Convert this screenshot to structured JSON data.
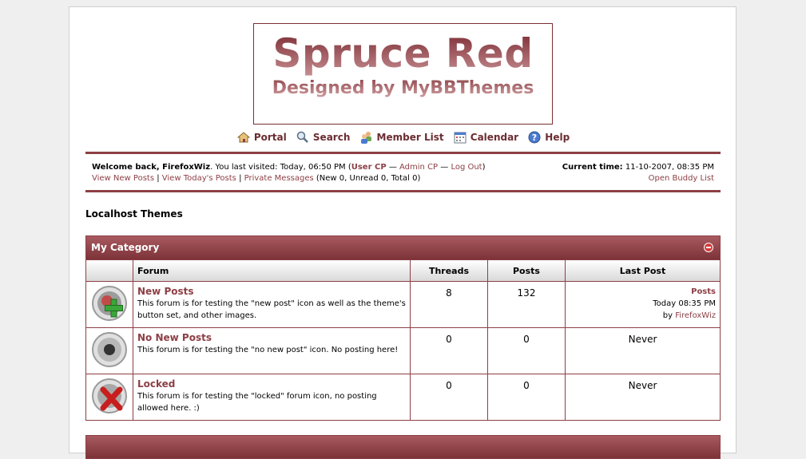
{
  "logo": {
    "title": "Spruce Red",
    "subtitle": "Designed by MyBBThemes"
  },
  "menu": [
    {
      "label": "Portal",
      "icon": "home-icon"
    },
    {
      "label": "Search",
      "icon": "search-icon"
    },
    {
      "label": "Member List",
      "icon": "members-icon"
    },
    {
      "label": "Calendar",
      "icon": "calendar-icon"
    },
    {
      "label": "Help",
      "icon": "help-icon"
    }
  ],
  "panel": {
    "welcome": "Welcome back, FirefoxWiz",
    "last_visit": ". You last visited: Today, 06:50 PM (",
    "user_cp": "User CP",
    "sep1": " — ",
    "admin_cp": "Admin CP",
    "sep2": " — ",
    "logout": "Log Out",
    "close_paren": ")",
    "view_new": "View New Posts",
    "pipe1": " | ",
    "view_today": "View Today's Posts",
    "pipe2": " | ",
    "pm": "Private Messages",
    "pm_counts": " (New 0, Unread 0, Total 0)",
    "time_label": "Current time:",
    "time_value": " 11-10-2007, 08:35 PM",
    "buddy": "Open Buddy List"
  },
  "board_title": "Localhost Themes",
  "category": {
    "title": "My Category",
    "columns": {
      "forum": "Forum",
      "threads": "Threads",
      "posts": "Posts",
      "last_post": "Last Post"
    },
    "forums": [
      {
        "name": "New Posts",
        "description": "This forum is for testing the \"new post\" icon as well as the theme's button set, and other images.",
        "threads": "8",
        "posts": "132",
        "last_post_title": "Posts",
        "last_post_time": "Today 08:35 PM",
        "last_post_by": "by ",
        "last_post_user": "FirefoxWiz",
        "status": "new"
      },
      {
        "name": "No New Posts",
        "description": "This forum is for testing the \"no new post\" icon. No posting here!",
        "threads": "0",
        "posts": "0",
        "last_post_never": "Never",
        "status": "old"
      },
      {
        "name": "Locked",
        "description": "This forum is for testing the \"locked\" forum icon, no posting allowed here. :)",
        "threads": "0",
        "posts": "0",
        "last_post_never": "Never",
        "status": "locked"
      }
    ]
  }
}
